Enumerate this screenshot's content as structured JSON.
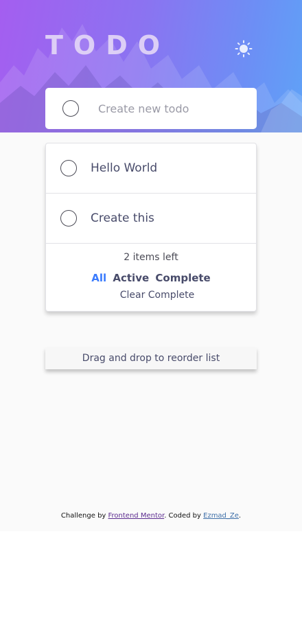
{
  "header": {
    "logo": "TODO",
    "theme_toggle_icon": "sun-icon"
  },
  "new_todo": {
    "placeholder": "Create new todo"
  },
  "todos": [
    {
      "text": "Hello World",
      "completed": false
    },
    {
      "text": "Create this",
      "completed": false
    }
  ],
  "footer": {
    "items_left": "2 items left",
    "filters": {
      "all": "All",
      "active": "Active",
      "complete": "Complete"
    },
    "selected_filter": "All",
    "clear": "Clear Complete"
  },
  "hint": "Drag and drop to reorder list",
  "attribution": {
    "prefix": "Challenge by ",
    "link1": "Frontend Mentor",
    "middle": ". Coded by ",
    "link2": "Ezmad_Ze",
    "suffix": "."
  },
  "colors": {
    "accent": "#3a7bfd",
    "text": "#484b6a",
    "gradient_start": "#a45ef0",
    "gradient_end": "#5fa2f7"
  }
}
